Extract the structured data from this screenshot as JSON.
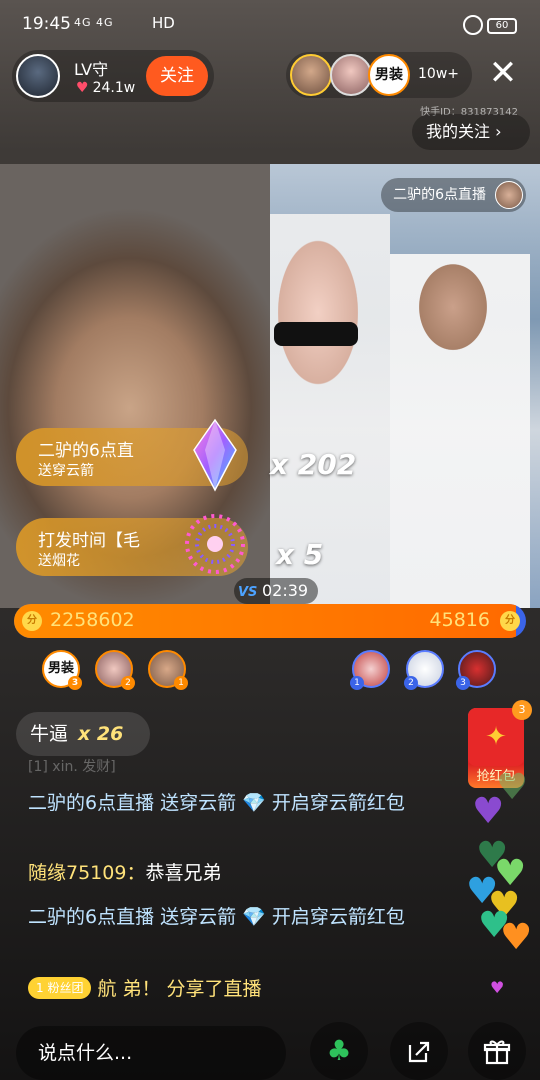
{
  "status_bar": {
    "time": "19:45",
    "signal": "4G 4G",
    "network": "HD",
    "battery": "60"
  },
  "host": {
    "name": "LV守",
    "likes": "24.1w",
    "follow_label": "关注"
  },
  "viewers": {
    "count": "10w+",
    "avatar3_label": "男装"
  },
  "kuaishou_id": "快手ID：831873142",
  "my_follow": "我的关注",
  "opponent_tag": "二驴的6点直播",
  "gifts": [
    {
      "name": "二驴的6点直",
      "action": "送穿云箭",
      "combo": "x 202"
    },
    {
      "name": "打发时间【毛",
      "action": "送烟花",
      "combo": "x 5"
    }
  ],
  "pk": {
    "timer": "02:39",
    "vs_label": "VS",
    "left_score": "2258602",
    "right_score": "45816",
    "left_fraction": 0.98,
    "coin_label": "分",
    "left_ranks": [
      {
        "label": "男装",
        "rank": "3"
      },
      {
        "label": "",
        "rank": "2"
      },
      {
        "label": "",
        "rank": "1"
      }
    ],
    "right_ranks": [
      {
        "rank": "1"
      },
      {
        "rank": "2"
      },
      {
        "rank": "3"
      }
    ]
  },
  "big_comment": {
    "text": "牛逼",
    "combo": "x 26"
  },
  "chat": {
    "faded": "[1] xin. 发财]",
    "line1": {
      "user": "二驴的6点直播",
      "text": "送穿云箭 💎 开启穿云箭红包"
    },
    "line2": {
      "user": "随缘75109：",
      "text": "恭喜兄弟"
    },
    "line3": {
      "user": "二驴的6点直播",
      "text": "送穿云箭 💎 开启穿云箭红包"
    },
    "line4": {
      "badge": "1 粉丝团",
      "user": "航 弟！",
      "text": "分享了直播"
    }
  },
  "red_packet": {
    "label": "抢红包",
    "count": "3"
  },
  "bottom": {
    "placeholder": "说点什么..."
  },
  "colors": {
    "accent": "#ff5a1f",
    "pk_left": "#ff7a00",
    "pk_right": "#3b64e8"
  }
}
